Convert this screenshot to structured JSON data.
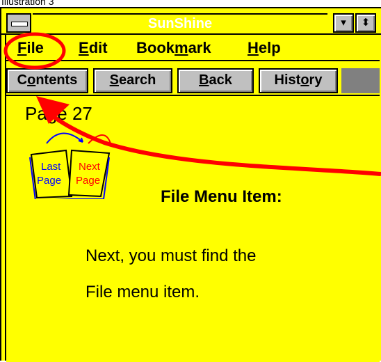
{
  "caption": "Illustration 3",
  "window": {
    "title": "SunShine",
    "minimize_glyph": "▾",
    "maximize_glyph": "⬍"
  },
  "menu": {
    "file": {
      "mnemonic": "F",
      "rest": "ile"
    },
    "edit": {
      "mnemonic": "E",
      "rest": "dit"
    },
    "bookmark": {
      "pre": "Book",
      "mnemonic": "m",
      "rest": "ark"
    },
    "help": {
      "mnemonic": "H",
      "rest": "elp"
    }
  },
  "buttons": {
    "contents": {
      "pre": "C",
      "mnemonic": "o",
      "rest": "ntents"
    },
    "search": {
      "mnemonic": "S",
      "rest": "earch"
    },
    "back": {
      "mnemonic": "B",
      "rest": "ack"
    },
    "history": {
      "pre": "Hist",
      "mnemonic": "o",
      "rest": "ry"
    }
  },
  "content": {
    "page_number": "Page 27",
    "book_left": [
      "Last",
      "Page"
    ],
    "book_right": [
      "Next",
      "Page"
    ],
    "heading": "File Menu Item:",
    "body_lines": [
      "Next, you must find the",
      "File menu item."
    ]
  },
  "colors": {
    "window_bg": "#ffff00",
    "annotation": "#ff0000",
    "button_face": "#c0c0c0",
    "book_page": "#ffff00",
    "book_text_left": "#0000ff",
    "book_text_right": "#ff0000"
  }
}
